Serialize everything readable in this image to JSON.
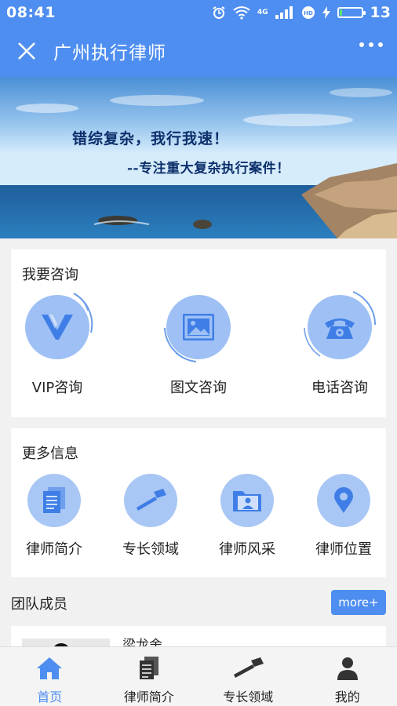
{
  "status": {
    "time": "08:41",
    "network": "4G",
    "battery_level": 13,
    "battery_text": "13"
  },
  "header": {
    "title": "广州执行律师"
  },
  "banner": {
    "slogan1": "错综复杂，我行我速！",
    "slogan2": "--专注重大复杂执行案件！"
  },
  "consult": {
    "title": "我要咨询",
    "items": [
      {
        "label": "VIP咨询",
        "icon": "vip-icon"
      },
      {
        "label": "图文咨询",
        "icon": "image-icon"
      },
      {
        "label": "电话咨询",
        "icon": "telephone-icon"
      }
    ]
  },
  "more_info": {
    "title": "更多信息",
    "items": [
      {
        "label": "律师简介",
        "icon": "document-icon"
      },
      {
        "label": "专长领域",
        "icon": "gavel-icon"
      },
      {
        "label": "律师风采",
        "icon": "folder-icon"
      },
      {
        "label": "律师位置",
        "icon": "location-icon"
      }
    ]
  },
  "team": {
    "title": "团队成员",
    "more_label": "more+",
    "members": [
      {
        "name": "梁龙舍"
      }
    ]
  },
  "tabbar": {
    "items": [
      {
        "label": "首页",
        "icon": "home-icon",
        "active": true
      },
      {
        "label": "律师简介",
        "icon": "document-icon"
      },
      {
        "label": "专长领域",
        "icon": "gavel-icon"
      },
      {
        "label": "我的",
        "icon": "person-icon"
      }
    ]
  },
  "colors": {
    "primary": "#4e8ef0",
    "icon_circle": "#9ec0f5"
  }
}
